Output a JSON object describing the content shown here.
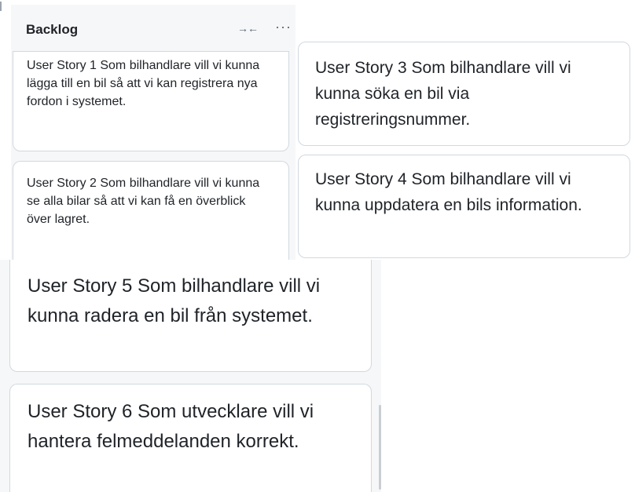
{
  "column": {
    "title": "Backlog",
    "collapse_icon": "→←",
    "more_icon": "···"
  },
  "cards": [
    {
      "text": "User Story 1 Som bilhandlare vill vi kunna lägga till en bil så att vi kan registrera nya fordon i systemet."
    },
    {
      "text": "User Story 2 Som bilhandlare vill vi kunna se alla bilar så att vi kan få en överblick över lagret."
    },
    {
      "text": "User Story 3 Som bilhandlare vill vi kunna söka en bil via registreringsnummer."
    },
    {
      "text": "User Story 4 Som bilhandlare vill vi kunna uppdatera en bils information."
    },
    {
      "text": "User Story 5 Som bilhandlare vill vi kunna radera en bil från systemet."
    },
    {
      "text": "User Story 6 Som utvecklare vill vi hantera felmeddelanden korrekt."
    }
  ]
}
